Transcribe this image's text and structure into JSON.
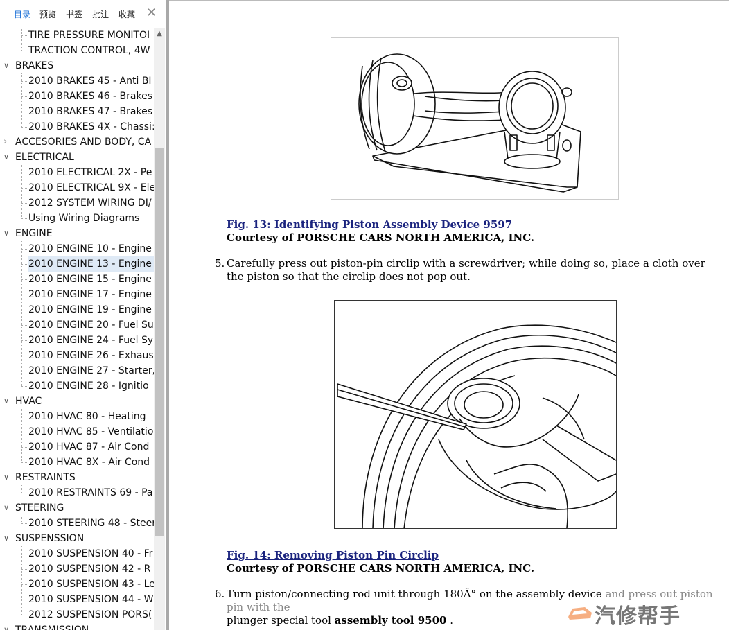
{
  "sidebar": {
    "tabs": [
      {
        "label": "目录",
        "active": true
      },
      {
        "label": "预览",
        "active": false
      },
      {
        "label": "书签",
        "active": false
      },
      {
        "label": "批注",
        "active": false
      },
      {
        "label": "收藏",
        "active": false
      }
    ],
    "close_icon": "close-icon",
    "tree": [
      {
        "kind": "child",
        "label": "TIRE PRESSURE MONITOI"
      },
      {
        "kind": "child",
        "label": "TRACTION CONTROL, 4W"
      },
      {
        "kind": "cat",
        "label": "BRAKES",
        "expanded": true
      },
      {
        "kind": "child",
        "label": "2010 BRAKES 45 - Anti BI"
      },
      {
        "kind": "child",
        "label": "2010 BRAKES 46 - Brakes"
      },
      {
        "kind": "child",
        "label": "2010 BRAKES 47 - Brakes"
      },
      {
        "kind": "child",
        "label": "2010 BRAKES 4X - Chassi:"
      },
      {
        "kind": "cat",
        "label": "ACCESORIES AND BODY, CA",
        "expanded": false
      },
      {
        "kind": "cat",
        "label": "ELECTRICAL",
        "expanded": true
      },
      {
        "kind": "child",
        "label": "2010 ELECTRICAL 2X - Pe"
      },
      {
        "kind": "child",
        "label": "2010 ELECTRICAL 9X - Ele"
      },
      {
        "kind": "child",
        "label": "2012 SYSTEM WIRING DI/"
      },
      {
        "kind": "child",
        "label": "Using Wiring Diagrams"
      },
      {
        "kind": "cat",
        "label": "ENGINE",
        "expanded": true
      },
      {
        "kind": "child",
        "label": "2010 ENGINE 10 - Engine"
      },
      {
        "kind": "child",
        "label": "2010 ENGINE 13 - Engine",
        "selected": true
      },
      {
        "kind": "child",
        "label": "2010 ENGINE 15 - Engine"
      },
      {
        "kind": "child",
        "label": "2010 ENGINE 17 - Engine"
      },
      {
        "kind": "child",
        "label": "2010 ENGINE 19 - Engine"
      },
      {
        "kind": "child",
        "label": "2010 ENGINE 20 - Fuel Su"
      },
      {
        "kind": "child",
        "label": "2010 ENGINE 24 - Fuel Sy"
      },
      {
        "kind": "child",
        "label": "2010 ENGINE 26 - Exhaus"
      },
      {
        "kind": "child",
        "label": "2010 ENGINE 27 - Starter,"
      },
      {
        "kind": "child",
        "label": "2010 ENGINE 28 - Ignitio"
      },
      {
        "kind": "cat",
        "label": "HVAC",
        "expanded": true
      },
      {
        "kind": "child",
        "label": "2010 HVAC 80 - Heating"
      },
      {
        "kind": "child",
        "label": "2010 HVAC 85 - Ventilatio"
      },
      {
        "kind": "child",
        "label": "2010 HVAC 87 - Air Cond"
      },
      {
        "kind": "child",
        "label": "2010 HVAC 8X - Air Cond"
      },
      {
        "kind": "cat",
        "label": "RESTRAINTS",
        "expanded": true
      },
      {
        "kind": "child",
        "label": "2010 RESTRAINTS 69 - Pa"
      },
      {
        "kind": "cat",
        "label": "STEERING",
        "expanded": true
      },
      {
        "kind": "child",
        "label": "2010 STEERING 48 - Steer"
      },
      {
        "kind": "cat",
        "label": "SUSPENSSION",
        "expanded": true
      },
      {
        "kind": "child",
        "label": "2010 SUSPENSION 40 - Fr"
      },
      {
        "kind": "child",
        "label": "2010 SUSPENSION 42 - R"
      },
      {
        "kind": "child",
        "label": "2010 SUSPENSION 43 - Le"
      },
      {
        "kind": "child",
        "label": "2010 SUSPENSION 44 - W"
      },
      {
        "kind": "child",
        "label": "2012 SUSPENSION PORS("
      },
      {
        "kind": "cat",
        "label": "TRANSMISSION",
        "expanded": true
      }
    ]
  },
  "document": {
    "fig13": {
      "caption": "Fig. 13: Identifying Piston Assembly Device 9597",
      "courtesy": "Courtesy of PORSCHE CARS NORTH AMERICA, INC."
    },
    "step5": {
      "num": "5.",
      "text": "Carefully press out piston-pin circlip with a screwdriver; while doing so, place a cloth over the piston so that the circlip does not pop out."
    },
    "fig14": {
      "caption": "Fig. 14: Removing Piston Pin Circlip",
      "courtesy": "Courtesy of PORSCHE CARS NORTH AMERICA, INC."
    },
    "step6": {
      "num": "6.",
      "text_a": "Turn piston/connecting rod unit through 180Â° on the assembly device ",
      "text_b": "and press out piston pin with the",
      "text_c": "plunger special tool ",
      "text_bold": "assembly tool 9500",
      "text_d": " ."
    }
  },
  "watermark": {
    "text": "汽修帮手",
    "logo_icon": "car-logo-icon"
  }
}
